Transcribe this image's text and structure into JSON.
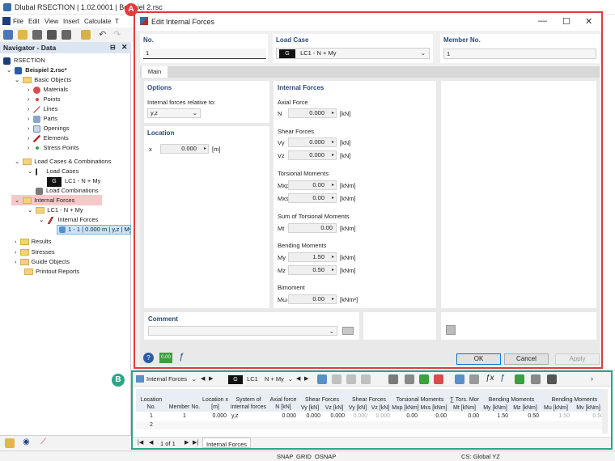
{
  "app": {
    "title": "Dlubal RSECTION | 1.02.0001 | Beispiel 2.rsc"
  },
  "menu": [
    "File",
    "Edit",
    "View",
    "Insert",
    "Calculate",
    "T"
  ],
  "navigator": {
    "title": "Navigator - Data",
    "root": "RSECTION",
    "file": "Beispiel 2.rsc*",
    "items": {
      "basic_objects": "Basic Objects",
      "materials": "Materials",
      "points": "Points",
      "lines": "Lines",
      "parts": "Parts",
      "openings": "Openings",
      "elements": "Elements",
      "stress_points": "Stress Points",
      "load_cases_combos": "Load Cases & Combinations",
      "load_cases": "Load Cases",
      "lc_badge": "G",
      "lc1": "LC1 - N + My",
      "load_combinations": "Load Combinations",
      "internal_forces": "Internal Forces",
      "lc1_short": "LC1 - N + My",
      "internal_forces_sub": "Internal Forces",
      "if_item": "1 - 1 | 0.000 m | y,z | My",
      "results": "Results",
      "stresses": "Stresses",
      "guide_objects": "Guide Objects",
      "printout_reports": "Printout Reports"
    }
  },
  "dialog": {
    "title": "Edit Internal Forces",
    "no_label": "No.",
    "no_value": "1",
    "load_case_label": "Load Case",
    "load_case_badge": "G",
    "load_case_value": "LC1 - N + My",
    "member_no_label": "Member No.",
    "member_no_value": "1",
    "tab_main": "Main",
    "options_label": "Options",
    "relative_label": "Internal forces relative to:",
    "relative_value": "y,z",
    "location_label": "Location",
    "x_label": "x",
    "x_value": "0.000",
    "x_unit": "[m]",
    "if_label": "Internal Forces",
    "axial_label": "Axial Force",
    "n_label": "N",
    "n_value": "0.000",
    "n_unit": "[kN]",
    "shear_label": "Shear Forces",
    "vy_label": "Vy",
    "vy_value": "0.000",
    "vy_unit": "[kN]",
    "vz_label": "Vz",
    "vz_value": "0.000",
    "vz_unit": "[kN]",
    "torsion_label": "Torsional Moments",
    "mxp_label": "Mxp",
    "mxp_value": "0.00",
    "mxp_unit": "[kNm]",
    "mxs_label": "Mxs",
    "mxs_value": "0.00",
    "mxs_unit": "[kNm]",
    "sumtors_label": "Sum of Torsional Moments",
    "mt_label": "Mt",
    "mt_value": "0.00",
    "mt_unit": "[kNm]",
    "bending_label": "Bending Moments",
    "my_label": "My",
    "my_value": "1.50",
    "my_unit": "[kNm]",
    "mz_label": "Mz",
    "mz_value": "0.50",
    "mz_unit": "[kNm]",
    "bimoment_label": "Bimoment",
    "mw_label": "Mω",
    "mw_value": "0.00",
    "mw_unit": "[kNm²]",
    "comment_label": "Comment",
    "ok": "OK",
    "cancel": "Cancel",
    "apply": "Apply",
    "marker_a": "A"
  },
  "table": {
    "marker_b": "B",
    "dropdown": "Internal Forces",
    "lc_badge": "G",
    "lc_label": "LC1",
    "lc_value": "N + My",
    "headers": {
      "location_no": "Location No.",
      "member_no": "Member No.",
      "location_x": "Location x [m]",
      "system": "System of internal forces",
      "axial": "Axial force N [kN]",
      "shear": "Shear Forces",
      "vy": "Vy [kN]",
      "vz": "Vz [kN]",
      "shear2": "Shear Forces",
      "vy2": "Vy [kN]",
      "vz2": "Vz [kN]",
      "torsion": "Torsional Moments",
      "mxp": "Mxp [kNm]",
      "mxs": "Mxs [kNm]",
      "tors_mom": "∑ Tors. Mor",
      "mt": "Mt [kNm]",
      "bending": "Bending Moments",
      "my": "My [kNm]",
      "mz": "Mz [kNm]",
      "bending2": "Bending Moments",
      "mu": "Mu [kNm]",
      "mv": "Mv [kNm]"
    },
    "rows": [
      {
        "no": "1",
        "member": "1",
        "x": "0.000",
        "system": "y,z",
        "n": "0.000",
        "vy": "0.000",
        "vz": "0.000",
        "vy2": "0.000",
        "vz2": "0.000",
        "mxp": "0.00",
        "mxs": "0.00",
        "mt": "0.00",
        "my": "1.50",
        "mz": "0.50",
        "mu": "1.50",
        "mv": "0.50"
      },
      {
        "no": "2"
      }
    ],
    "pager": "1 of 1",
    "sheet_tab": "Internal Forces"
  },
  "status": {
    "snap": "SNAP",
    "grid": "GRID",
    "osnap": "OSNAP",
    "cs": "CS: Global YZ"
  },
  "colors": {
    "red": "#e03c3c",
    "green": "#2aa686",
    "highlight": "#f8c8c8",
    "selected": "#cce4f7"
  }
}
